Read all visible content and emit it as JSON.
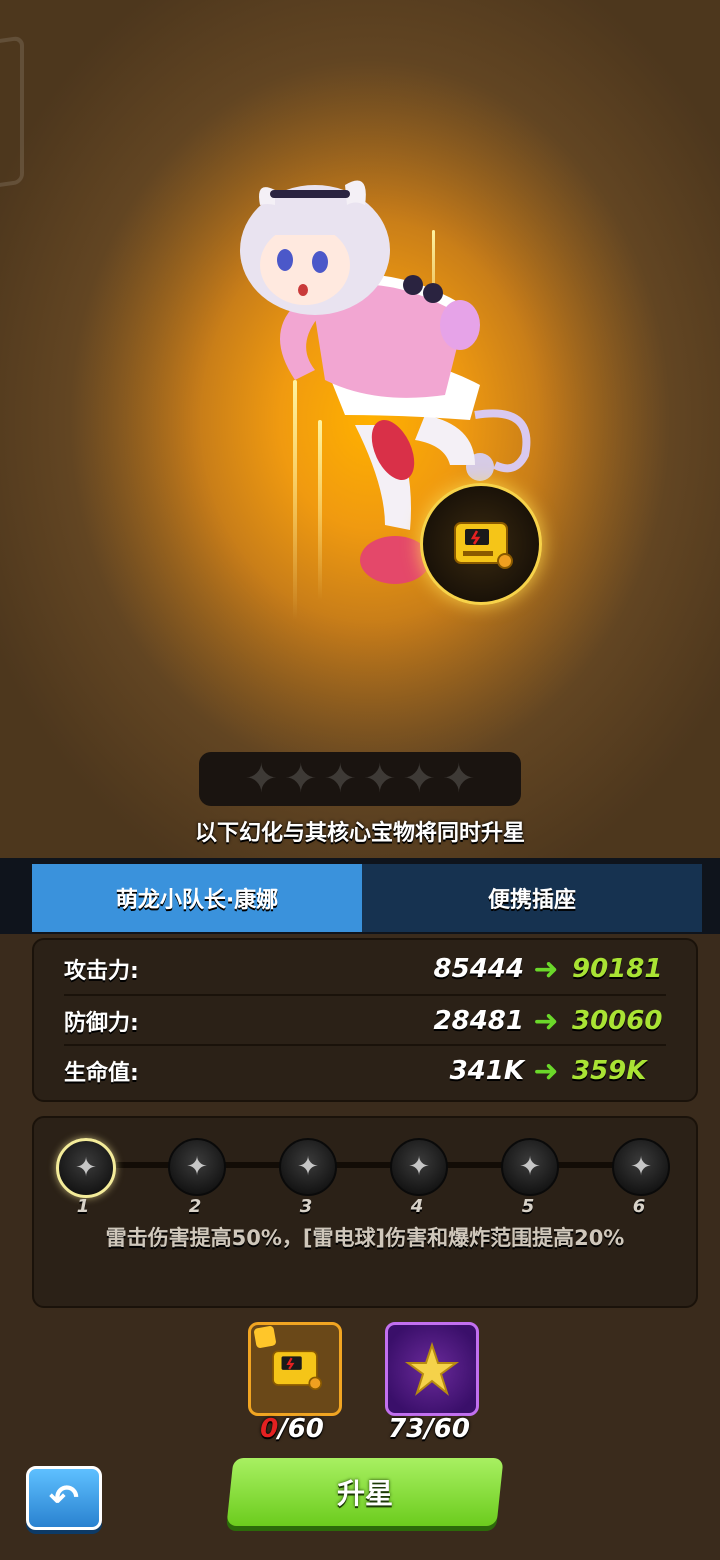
{
  "hero": {
    "name": "萌龙小队长·康娜",
    "stars_total": 6,
    "stars_filled": 0
  },
  "notice": "以下幻化与其核心宝物将同时升星",
  "tabs": [
    {
      "label": "萌龙小队长·康娜",
      "active": true
    },
    {
      "label": "便携插座",
      "active": false
    }
  ],
  "stats": [
    {
      "label": "攻击力:",
      "current": "85444",
      "next": "90181"
    },
    {
      "label": "防御力:",
      "current": "28481",
      "next": "30060"
    },
    {
      "label": "生命值:",
      "current": "341K",
      "next": "359K"
    }
  ],
  "levels": {
    "nodes": [
      "1",
      "2",
      "3",
      "4",
      "5",
      "6"
    ],
    "current": 1,
    "description": "雷击伤害提高50%，[雷电球]伤害和爆炸范围提高20%"
  },
  "materials": [
    {
      "icon": "portable-socket-shard-icon",
      "have": "0",
      "need": "60"
    },
    {
      "icon": "gold-star-icon",
      "have": "73",
      "need": "60"
    }
  ],
  "buttons": {
    "star_up": "升星",
    "back": "back-arrow-icon"
  },
  "colors": {
    "tab_active": "#3a92dc",
    "tab_inactive": "#163250",
    "stat_new": "#a9e334",
    "arrow": "#6bd82a",
    "star_up_button": "#8ee042",
    "insufficient": "#e42121"
  }
}
